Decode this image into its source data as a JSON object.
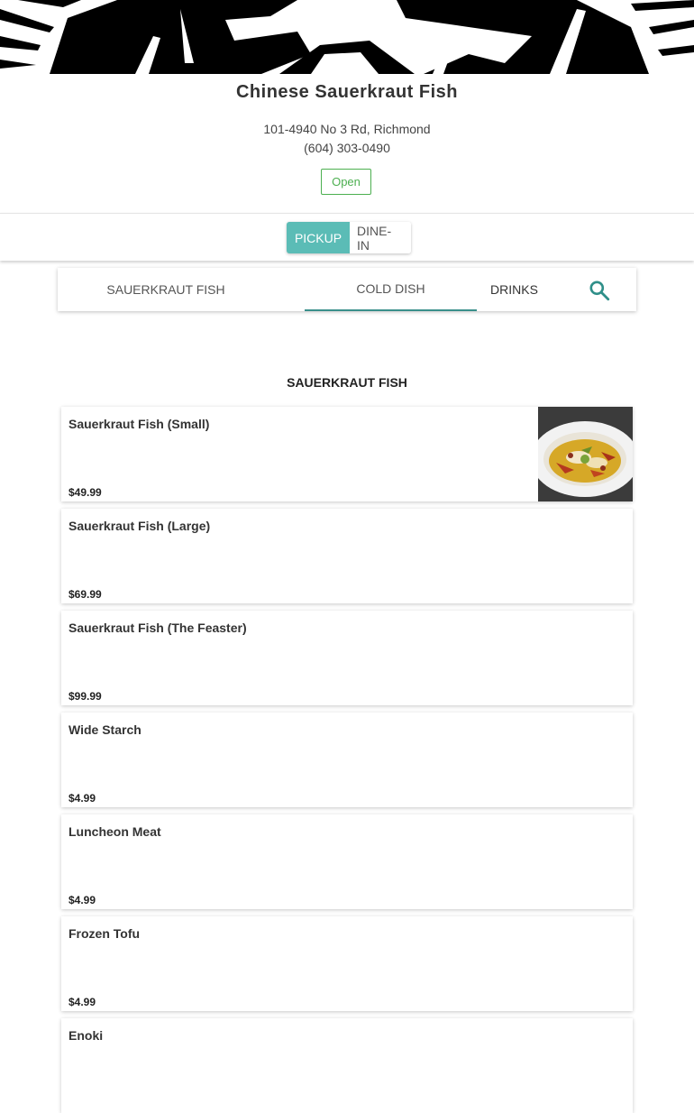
{
  "restaurant": {
    "name": "Chinese Sauerkraut Fish",
    "address": "101-4940 No 3 Rd, Richmond",
    "phone": "(604) 303-0490",
    "status": "Open"
  },
  "order_mode": {
    "options": [
      "PICKUP",
      "DINE-IN"
    ],
    "selected": "PICKUP"
  },
  "categories": {
    "tabs": [
      "SAUERKRAUT FISH",
      "COLD DISH",
      "DRINKS"
    ],
    "active": "COLD DISH",
    "search_icon": "search-icon"
  },
  "section": {
    "title": "SAUERKRAUT FISH",
    "items": [
      {
        "name": "Sauerkraut Fish (Small)",
        "price": "$49.99",
        "has_photo": true
      },
      {
        "name": "Sauerkraut Fish (Large)",
        "price": "$69.99"
      },
      {
        "name": "Sauerkraut Fish (The Feaster)",
        "price": "$99.99"
      },
      {
        "name": "Wide Starch",
        "price": "$4.99"
      },
      {
        "name": "Luncheon Meat",
        "price": "$4.99"
      },
      {
        "name": "Frozen Tofu",
        "price": "$4.99"
      },
      {
        "name": "Enoki",
        "price": ""
      }
    ]
  },
  "colors": {
    "accent": "#5bbcb6",
    "tab_underline": "#3a8f8b",
    "open_status": "#4caf50"
  }
}
